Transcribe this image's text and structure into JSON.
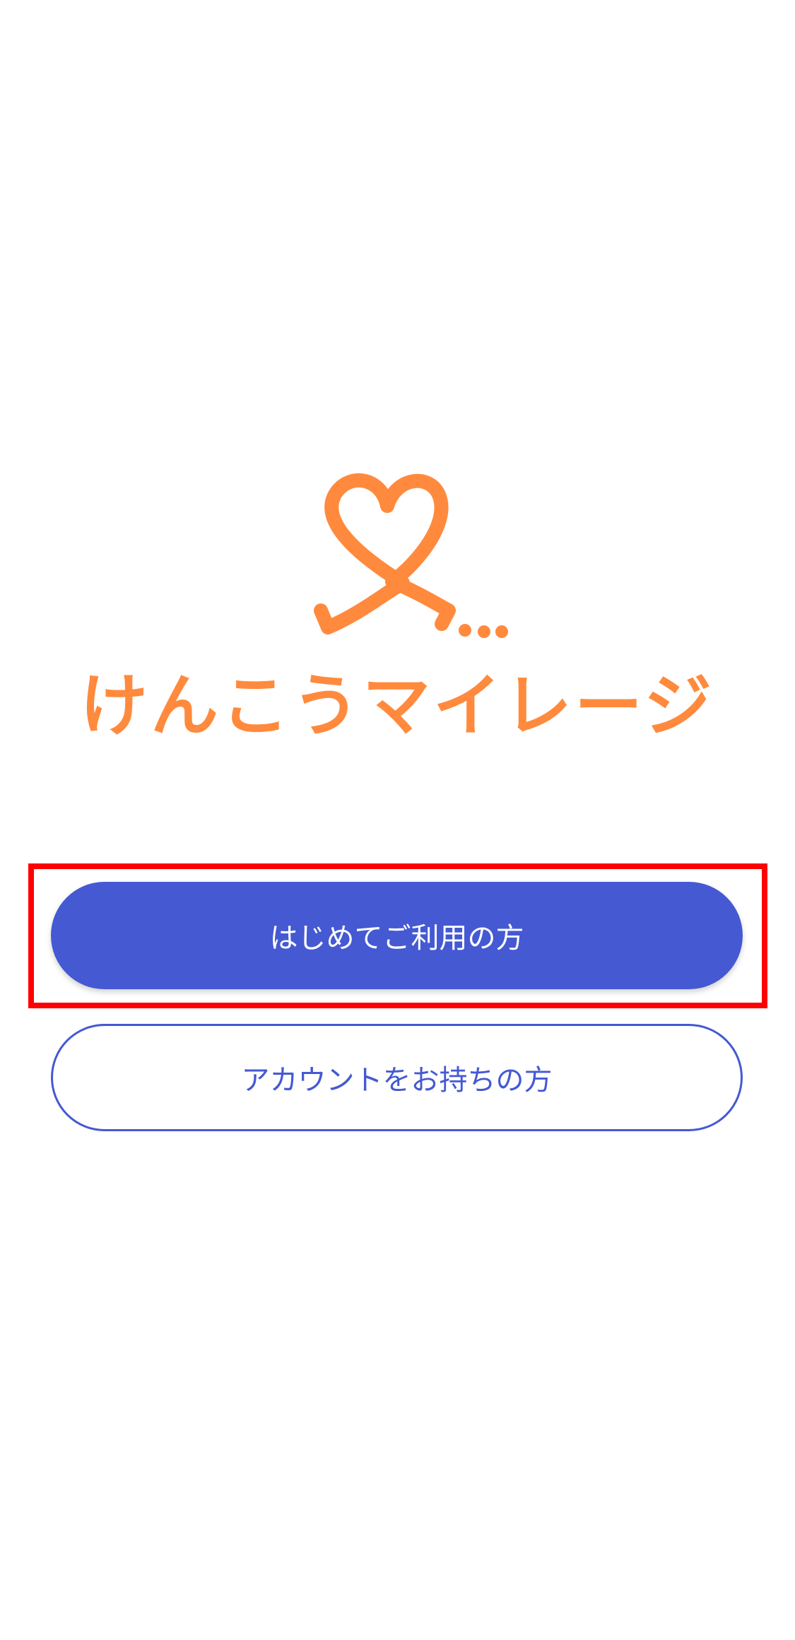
{
  "brand": {
    "title": "けんこうマイレージ",
    "logo_icon": "heart-ribbon-icon",
    "color": "#FF8A3D"
  },
  "buttons": {
    "first_time_label": "はじめてご利用の方",
    "has_account_label": "アカウントをお持ちの方",
    "accent_color": "#4559D2"
  },
  "highlight_color": "#FF0000"
}
